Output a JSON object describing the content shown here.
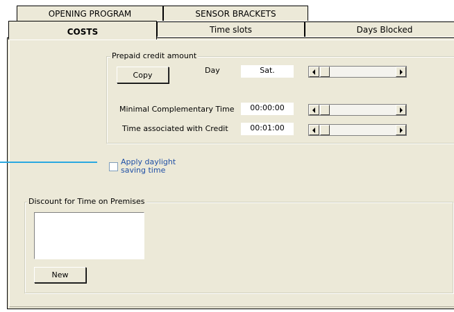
{
  "tabs": {
    "row1": [
      {
        "label": "OPENING PROGRAM"
      },
      {
        "label": "SENSOR BRACKETS"
      }
    ],
    "row2": [
      {
        "label": "COSTS",
        "active": true
      },
      {
        "label": "Time slots"
      },
      {
        "label": "Days Blocked"
      }
    ]
  },
  "prepaid": {
    "caption": "Prepaid credit amount",
    "copy_button": "Copy",
    "day_label": "Day",
    "day_value": "Sat.",
    "min_comp_label": "Minimal Complementary Time",
    "min_comp_value": "00:00:00",
    "time_credit_label": "Time associated with Credit",
    "time_credit_value": "00:01:00"
  },
  "daylight": {
    "label_line1": "Apply daylight",
    "label_line2": "saving time",
    "checked": false
  },
  "discount": {
    "caption": "Discount for Time on Premises",
    "new_button": "New"
  },
  "colors": {
    "panel_bg": "#ece9d8",
    "callout_line": "#29a8e0",
    "checkbox_label": "#1f4fa5"
  }
}
